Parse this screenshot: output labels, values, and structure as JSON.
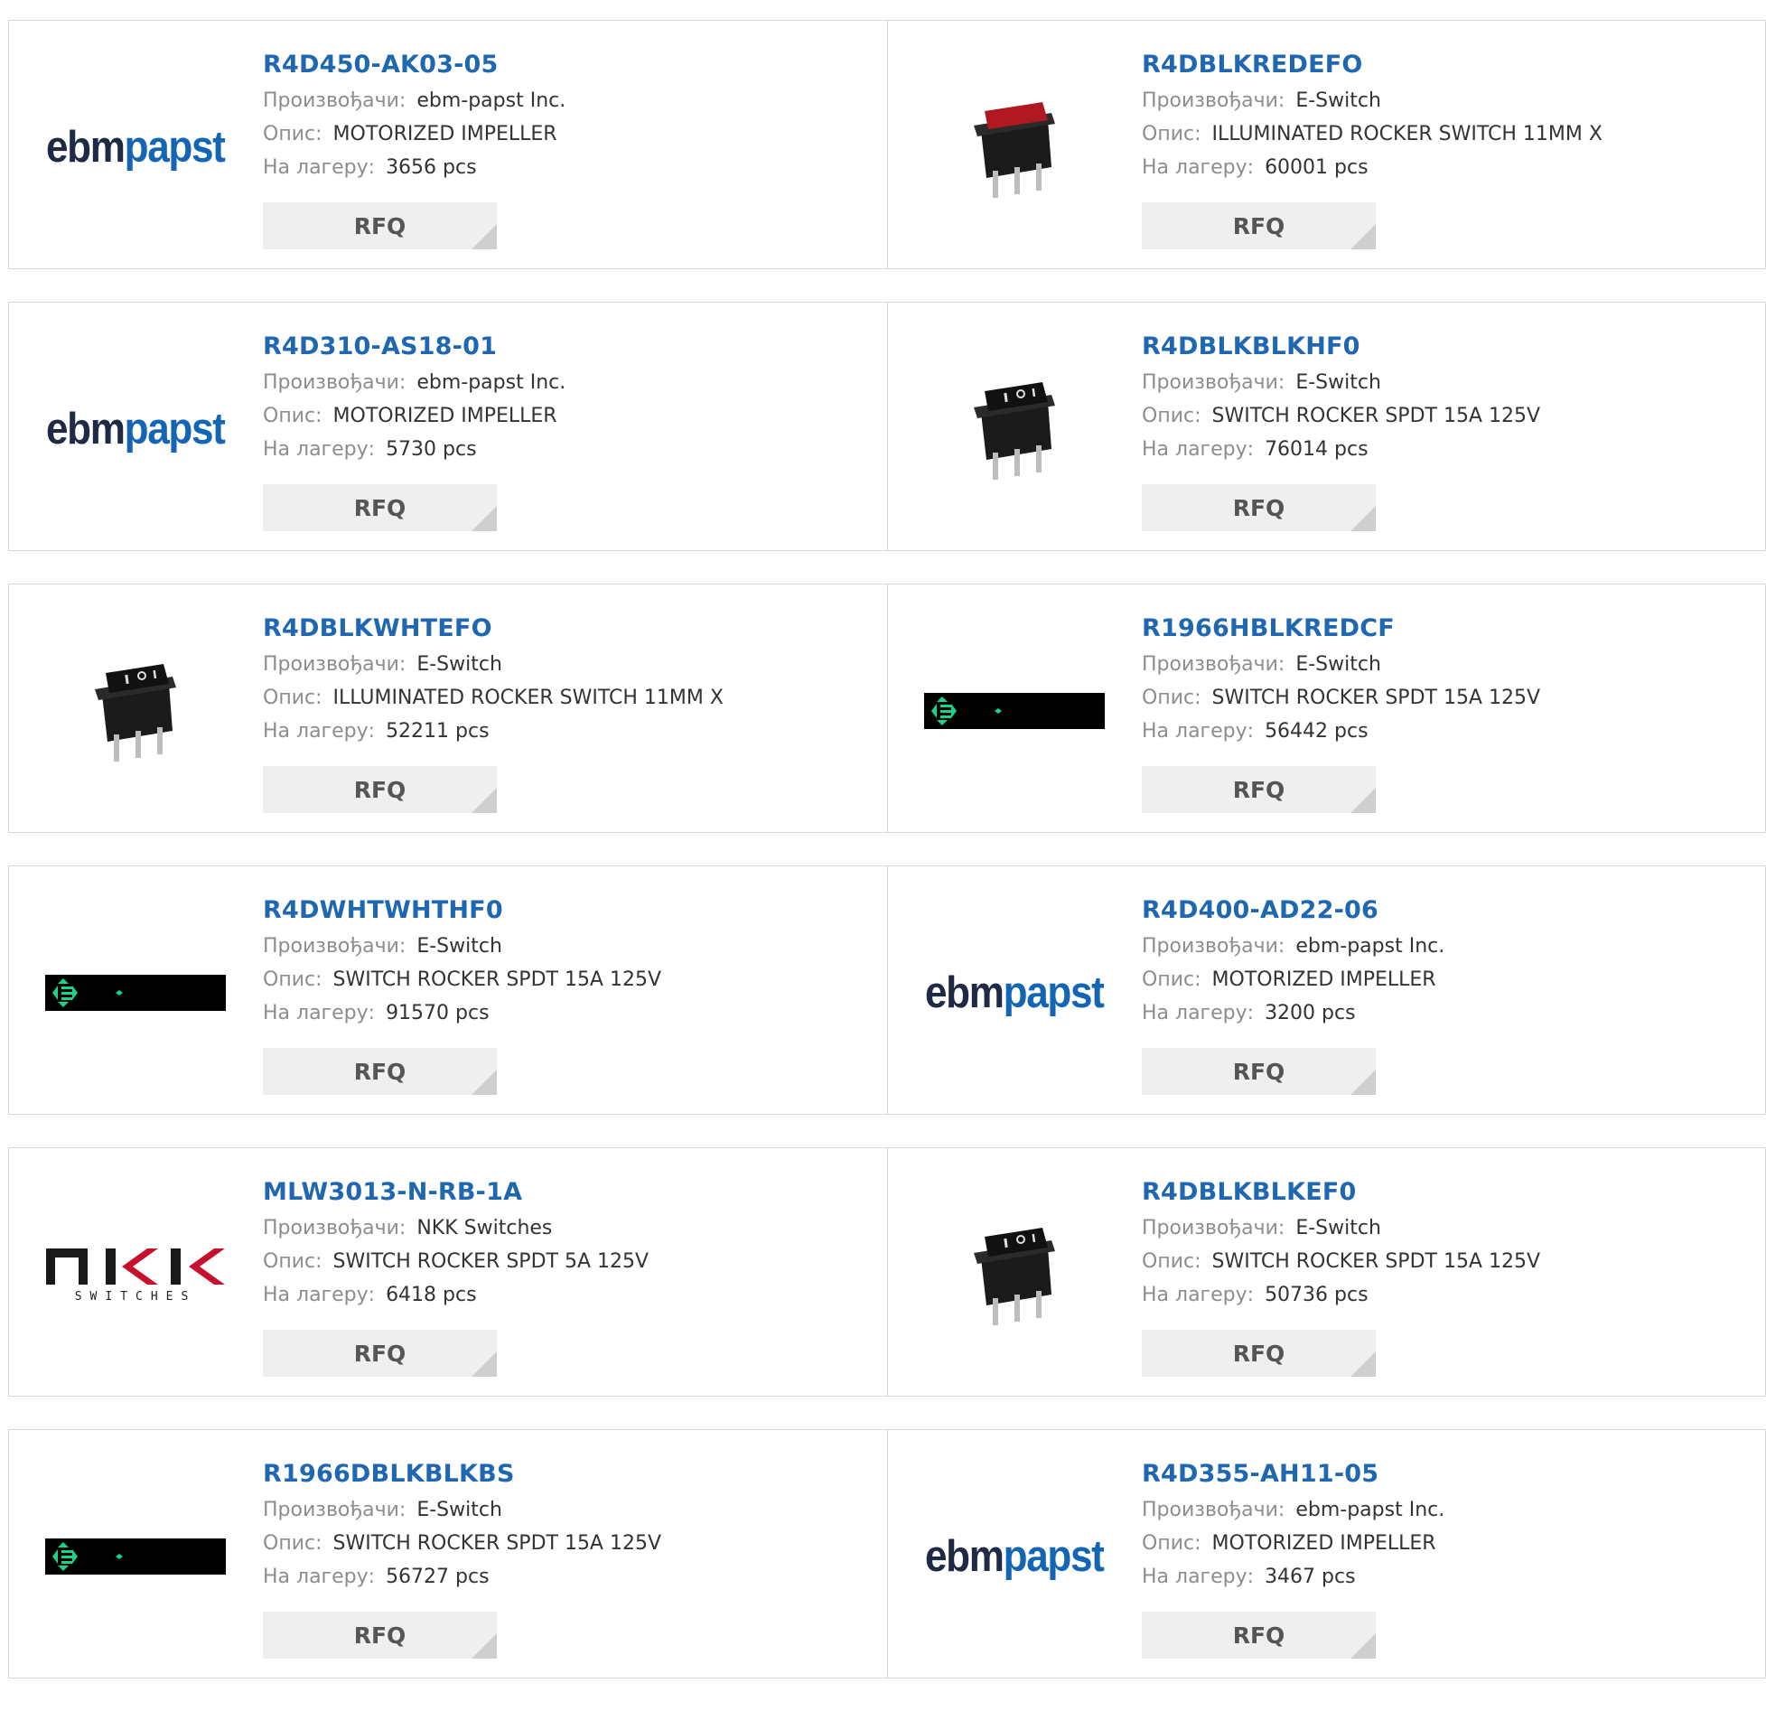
{
  "labels": {
    "manufacturer": "Произвођачи:",
    "description": "Опис:",
    "stock": "На лагеру:",
    "rfq": "RFQ"
  },
  "colors": {
    "part_link": "#1f67b1",
    "label_grey": "#8d8d8d",
    "rfq_bg": "#efefef",
    "ebm_dark": "#1f2a44",
    "ebm_blue": "#1565b5",
    "nkk_red": "#c8102e",
    "lcd_green": "#19d38a",
    "rocker_red": "#b01822"
  },
  "products": [
    {
      "part": "R4D450-AK03-05",
      "manufacturer": "ebm-papst Inc.",
      "description": "MOTORIZED IMPELLER",
      "stock": "3656 pcs",
      "image": "ebmpapst-logo",
      "logo_text_a": "ebm",
      "logo_text_b": "papst"
    },
    {
      "part": "R4DBLKREDEFO",
      "manufacturer": "E-Switch",
      "description": "ILLUMINATED ROCKER SWITCH 11MM X",
      "stock": "60001 pcs",
      "image": "red-rocker-switch-photo"
    },
    {
      "part": "R4D310-AS18-01",
      "manufacturer": "ebm-papst Inc.",
      "description": "MOTORIZED IMPELLER",
      "stock": "5730 pcs",
      "image": "ebmpapst-logo",
      "logo_text_a": "ebm",
      "logo_text_b": "papst"
    },
    {
      "part": "R4DBLKBLKHF0",
      "manufacturer": "E-Switch",
      "description": "SWITCH ROCKER SPDT 15A 125V",
      "stock": "76014 pcs",
      "image": "black-rocker-switch-photo"
    },
    {
      "part": "R4DBLKWHTEFO",
      "manufacturer": "E-Switch",
      "description": "ILLUMINATED ROCKER SWITCH 11MM X",
      "stock": "52211 pcs",
      "image": "black-rocker-switch-photo"
    },
    {
      "part": "R1966HBLKREDCF",
      "manufacturer": "E-Switch",
      "description": "SWITCH ROCKER SPDT 15A 125V",
      "stock": "56442 pcs",
      "image": "lcd-strip-icon"
    },
    {
      "part": "R4DWHTWHTHF0",
      "manufacturer": "E-Switch",
      "description": "SWITCH ROCKER SPDT 15A 125V",
      "stock": "91570 pcs",
      "image": "lcd-strip-icon"
    },
    {
      "part": "R4D400-AD22-06",
      "manufacturer": "ebm-papst Inc.",
      "description": "MOTORIZED IMPELLER",
      "stock": "3200 pcs",
      "image": "ebmpapst-logo",
      "logo_text_a": "ebm",
      "logo_text_b": "papst"
    },
    {
      "part": "MLW3013-N-RB-1A",
      "manufacturer": "NKK Switches",
      "description": "SWITCH ROCKER SPDT 5A 125V",
      "stock": "6418 pcs",
      "image": "nkk-logo",
      "logo_sub": "SWITCHES"
    },
    {
      "part": "R4DBLKBLKEF0",
      "manufacturer": "E-Switch",
      "description": "SWITCH ROCKER SPDT 15A 125V",
      "stock": "50736 pcs",
      "image": "black-rocker-switch-photo"
    },
    {
      "part": "R1966DBLKBLKBS",
      "manufacturer": "E-Switch",
      "description": "SWITCH ROCKER SPDT 15A 125V",
      "stock": "56727 pcs",
      "image": "lcd-strip-icon"
    },
    {
      "part": "R4D355-AH11-05",
      "manufacturer": "ebm-papst Inc.",
      "description": "MOTORIZED IMPELLER",
      "stock": "3467 pcs",
      "image": "ebmpapst-logo",
      "logo_text_a": "ebm",
      "logo_text_b": "papst"
    }
  ]
}
